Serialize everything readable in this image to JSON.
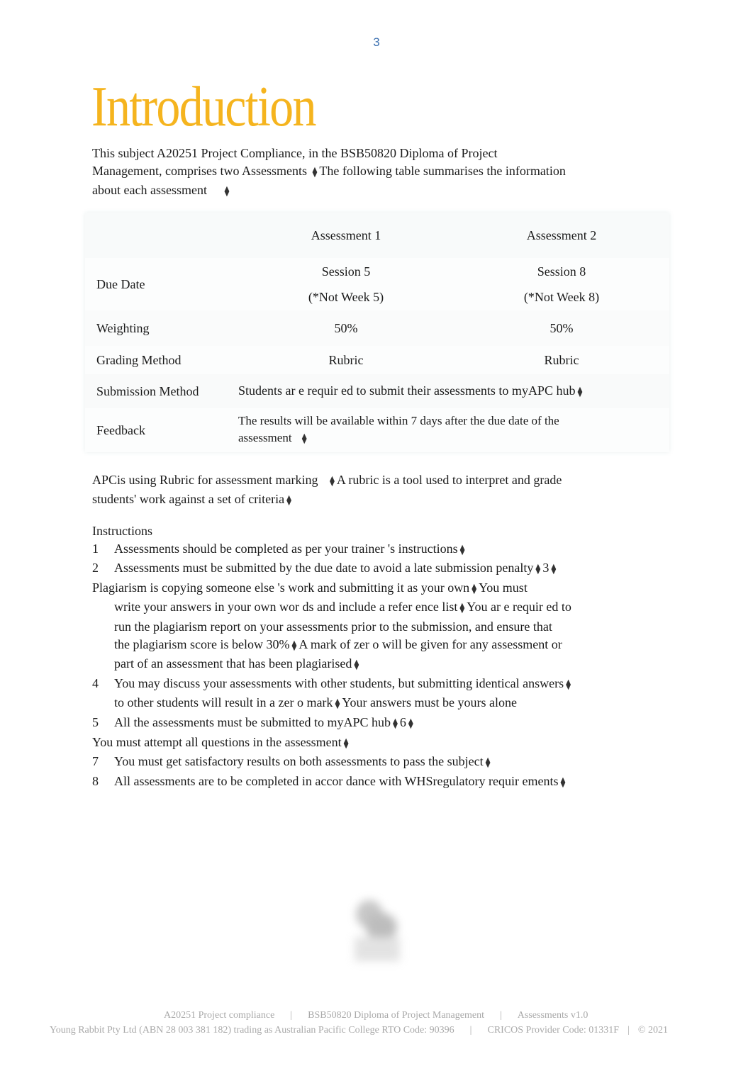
{
  "page": {
    "number": "3"
  },
  "title": "Introduction",
  "intro": {
    "line1": "This subject A20251 Project Compliance, in the BSB50820 Diploma of Project",
    "line2a": "Management,   comprises two   Assessments",
    "line2b": "The following   table   summarises   the  information",
    "line3": "about each assessment"
  },
  "table": {
    "headers": [
      "",
      "Assessment 1",
      "Assessment 2"
    ],
    "due_date": {
      "label": "Due Date",
      "a1": [
        "Session 5",
        "(*Not Week 5)"
      ],
      "a2": [
        "Session 8",
        "(*Not Week 8)"
      ]
    },
    "weighting": {
      "label": "Weighting",
      "a1": "50%",
      "a2": "50%"
    },
    "grading": {
      "label": "Grading Method",
      "a1": "Rubric",
      "a2": "Rubric"
    },
    "submission": {
      "label": "Submission Method",
      "text": "Students   ar e  requir ed  to submit   their   assessments to    myAPC hub"
    },
    "feedback": {
      "label": "Feedback",
      "line1": "The results will be available within 7 days after the due date of the",
      "line2": "assessment"
    }
  },
  "rubric_para": {
    "part1": "APCis using  Rubric for  assessment marking",
    "part2": "A rubric  is a  tool  used  to  interpret   and  grade",
    "part3": "students'   work against   a  set  of criteria"
  },
  "instructions": {
    "heading": "Instructions",
    "items": [
      {
        "num": "1",
        "text": "Assessments   should  be  completed as per your     trainer  's instructions"
      },
      {
        "num": "2",
        "text": "Assessments   must  be  submitted   by the  due  date to avoid    a late  submission  penalty",
        "tail": "3"
      },
      {
        "num": "",
        "text": "Plagiarism  is copying  someone   else 's work and  submitting   it as your  own",
        "tail_text": "You must"
      },
      {
        "num": "",
        "text": "write  your answers   in your own  wor ds and  include  a refer ence  list",
        "tail_text": "You ar e  requir ed  to",
        "indent": true
      },
      {
        "num": "",
        "text": "run the plagiarism report on your assessments prior to the submission, and ensure that",
        "indent": true
      },
      {
        "num": "",
        "text": "the  plagiarism score    is below  30%",
        "tail_text": "A mark  of zer o will  be  given  for any assessment or",
        "indent": true
      },
      {
        "num": "",
        "text": "part  of an assessment    that  has  been  plagiarised",
        "indent": true
      },
      {
        "num": "4",
        "text": "You may discuss your assessments     with  other  students,   but submitting    identical  answers"
      },
      {
        "num": "",
        "text": "to other   students   will result  in a  zer o  mark",
        "tail_text": "Your answers must    be  yours alone",
        "indent": true
      },
      {
        "num": "5",
        "text": "All the  assessments must    be  submitted to    myAPC hub",
        "tail": "6"
      },
      {
        "num": "",
        "text": "You must  attempt   all questions   in the  assessment"
      },
      {
        "num": "7",
        "text": "You must  get  satisfactory   results  on both  assessments to    pass  the  subject"
      },
      {
        "num": "8",
        "text": "All assessments   are to  be  completed    in accor dance  with  WHSregulatory   requir ements"
      }
    ]
  },
  "footer": {
    "line1": [
      "A20251 Project compliance",
      "BSB50820 Diploma of Project Management",
      "Assessments v1.0"
    ],
    "line2": [
      "Young Rabbit Pty Ltd (ABN 28 003 381 182) trading as Australian Pacific College RTO Code: 90396",
      "CRICOS Provider Code: 01331F",
      "© 2021"
    ],
    "separator": "|"
  },
  "glyphs": {
    "bullet_mark": "⧫"
  },
  "colors": {
    "title": "#f5b41e",
    "page_number": "#3a6fb0",
    "footer": "#a9a9a9"
  }
}
